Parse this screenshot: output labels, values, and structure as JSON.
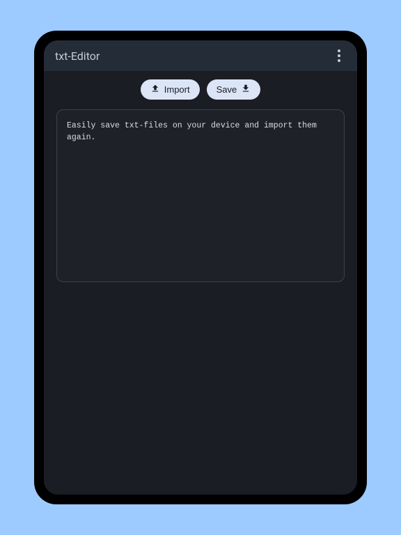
{
  "header": {
    "title": "txt-Editor"
  },
  "toolbar": {
    "import_label": "Import",
    "save_label": "Save"
  },
  "editor": {
    "content": "Easily save txt-files on your device and import them again."
  }
}
